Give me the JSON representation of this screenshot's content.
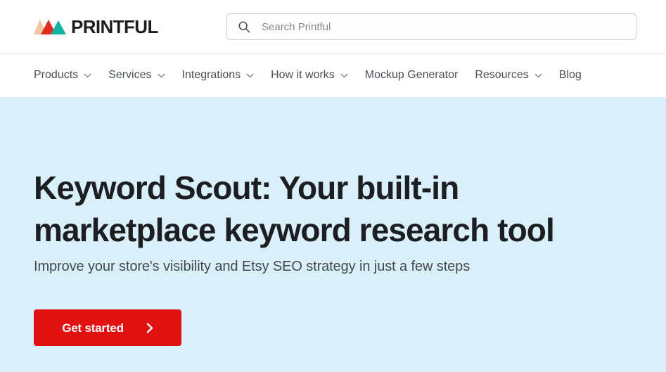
{
  "colors": {
    "hero_background": "#d9eff9",
    "cta_background": "#e31212",
    "cta_text": "#ffffff",
    "logo_peak_left": "#f0c9a4",
    "logo_peak_middle": "#e02b20",
    "logo_peak_right": "#12b3a0",
    "wordmark": "#1d1d1d",
    "nav_text": "#4a4f54",
    "headline_text": "#1c1e21",
    "subtitle_text": "#44494e",
    "search_border": "#c9ccd0",
    "search_placeholder": "#85898e",
    "header_divider": "#e7e7e7"
  },
  "header": {
    "logo": {
      "mark_icon": "printful-mountains-icon",
      "wordmark": "PRINTFUL"
    },
    "search": {
      "icon": "search-icon",
      "placeholder": "Search Printful",
      "value": ""
    }
  },
  "nav": {
    "items": [
      {
        "label": "Products",
        "has_dropdown": true,
        "caret_icon": "chevron-down-icon"
      },
      {
        "label": "Services",
        "has_dropdown": true,
        "caret_icon": "chevron-down-icon"
      },
      {
        "label": "Integrations",
        "has_dropdown": true,
        "caret_icon": "chevron-down-icon"
      },
      {
        "label": "How it works",
        "has_dropdown": true,
        "caret_icon": "chevron-down-icon"
      },
      {
        "label": "Mockup Generator",
        "has_dropdown": false,
        "caret_icon": ""
      },
      {
        "label": "Resources",
        "has_dropdown": true,
        "caret_icon": "chevron-down-icon"
      },
      {
        "label": "Blog",
        "has_dropdown": false,
        "caret_icon": ""
      }
    ]
  },
  "hero": {
    "title": "Keyword Scout: Your built-in marketplace keyword research tool",
    "subtitle": "Improve your store's visibility and Etsy SEO strategy in just a few steps",
    "cta": {
      "label": "Get started",
      "arrow_icon": "chevron-right-icon"
    }
  }
}
